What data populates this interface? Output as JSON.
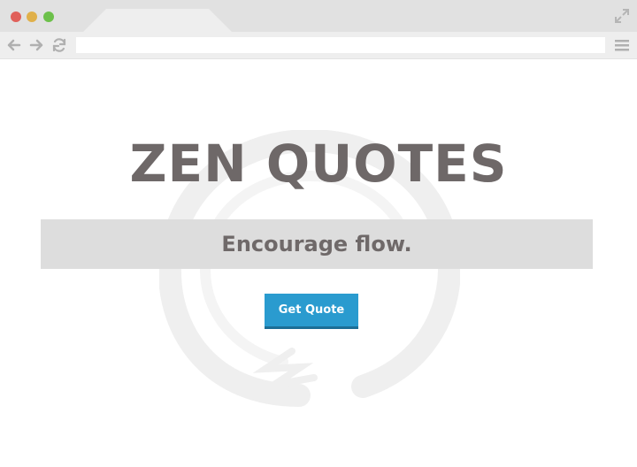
{
  "browser": {
    "address_value": "",
    "window_controls": [
      "close",
      "minimize",
      "maximize"
    ],
    "colors": {
      "close": "#e0605a",
      "minimize": "#e0b04a",
      "maximize": "#6cc04a",
      "chrome": "#e1e1e1"
    },
    "icons": [
      "arrow-left-icon",
      "arrow-right-icon",
      "reload-icon",
      "expand-icon",
      "hamburger-menu-icon"
    ]
  },
  "page": {
    "title": "ZEN QUOTES",
    "subtitle": "Encourage flow.",
    "cta_label": "Get Quote",
    "colors": {
      "title": "#6e6868",
      "banner": "#dddddd",
      "cta": "#2a9bcf"
    }
  }
}
